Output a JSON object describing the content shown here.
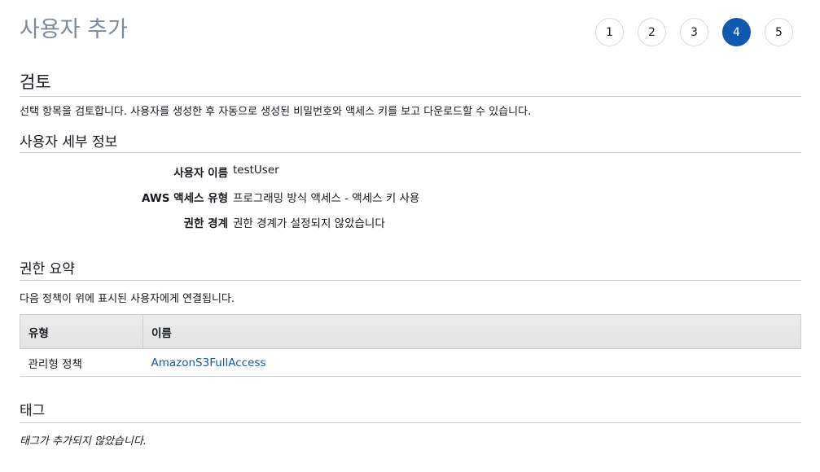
{
  "page": {
    "title": "사용자 추가"
  },
  "steps": [
    {
      "label": "1",
      "active": false
    },
    {
      "label": "2",
      "active": false
    },
    {
      "label": "3",
      "active": false
    },
    {
      "label": "4",
      "active": true
    },
    {
      "label": "5",
      "active": false
    }
  ],
  "colors": {
    "accent": "#0f5ab0",
    "title_gray": "#7d8998",
    "divider": "#c9cfd4"
  },
  "review": {
    "heading": "검토",
    "description": "선택 항목을 검토합니다. 사용자를 생성한 후 자동으로 생성된 비밀번호와 액세스 키를 보고 다운로드할 수 있습니다."
  },
  "user_details": {
    "heading": "사용자 세부 정보",
    "rows": [
      {
        "label": "사용자 이름",
        "value": "testUser"
      },
      {
        "label": "AWS 액세스 유형",
        "value": "프로그래밍 방식 액세스 - 액세스 키 사용"
      },
      {
        "label": "권한 경계",
        "value": "권한 경계가 설정되지 않았습니다"
      }
    ]
  },
  "permissions": {
    "heading": "권한 요약",
    "description": "다음 정책이 위에 표시된 사용자에게 연결됩니다.",
    "columns": [
      "유형",
      "이름"
    ],
    "rows": [
      {
        "type": "관리형 정책",
        "name": "AmazonS3FullAccess"
      }
    ]
  },
  "tags": {
    "heading": "태그",
    "empty_text": "태그가 추가되지 않았습니다."
  }
}
